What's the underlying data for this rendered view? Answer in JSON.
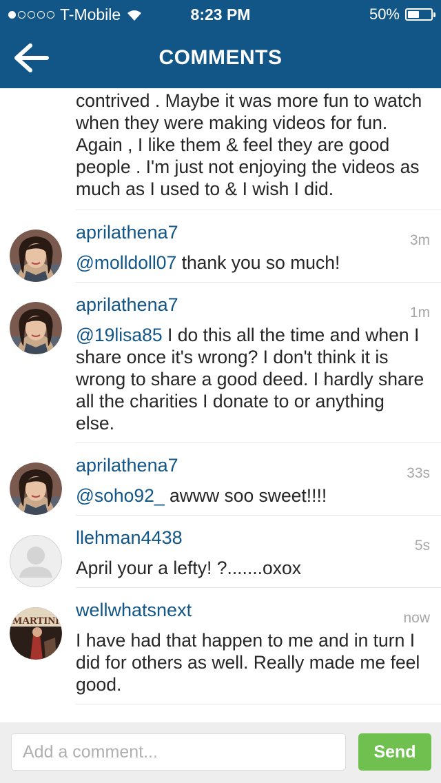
{
  "status": {
    "carrier": "T-Mobile",
    "signal_bars": 1,
    "time": "8:23 PM",
    "battery_text": "50%",
    "battery_level": 0.5
  },
  "nav": {
    "title": "COMMENTS",
    "back_icon": "back-arrow-icon"
  },
  "comments": [
    {
      "text": "contrived . Maybe it was more fun to watch when they were making videos for fun. Again , I like them & feel they are good people . I'm just not enjoying the videos as much as I used to & I wish I did."
    },
    {
      "username": "aprilathena7",
      "time": "3m",
      "mention": "@molldoll07",
      "text": " thank you so much!",
      "avatar": "woman-avatar"
    },
    {
      "username": "aprilathena7",
      "time": "1m",
      "mention": "@19lisa85",
      "text": " I do this all the time and when I share once it's wrong?  I don't think it is wrong to share a good deed. I hardly share all the charities I donate to or anything else.",
      "avatar": "woman-avatar"
    },
    {
      "username": "aprilathena7",
      "time": "33s",
      "mention": "@soho92_",
      "text": " awww soo sweet!!!!",
      "avatar": "woman-avatar"
    },
    {
      "username": "llehman4438",
      "time": "5s",
      "mention": "",
      "text": "April your a lefty! ?.......oxox",
      "avatar": "default-avatar"
    },
    {
      "username": "wellwhatsnext",
      "time": "now",
      "mention": "",
      "text": "I have had that happen to me and in turn I did for others as well. Really made me feel good.",
      "avatar": "magazine-avatar"
    }
  ],
  "composer": {
    "placeholder": "Add a comment...",
    "send_label": "Send"
  },
  "colors": {
    "brand_blue": "#125688",
    "send_green": "#70c050",
    "timestamp_gray": "#a7a7a7"
  }
}
